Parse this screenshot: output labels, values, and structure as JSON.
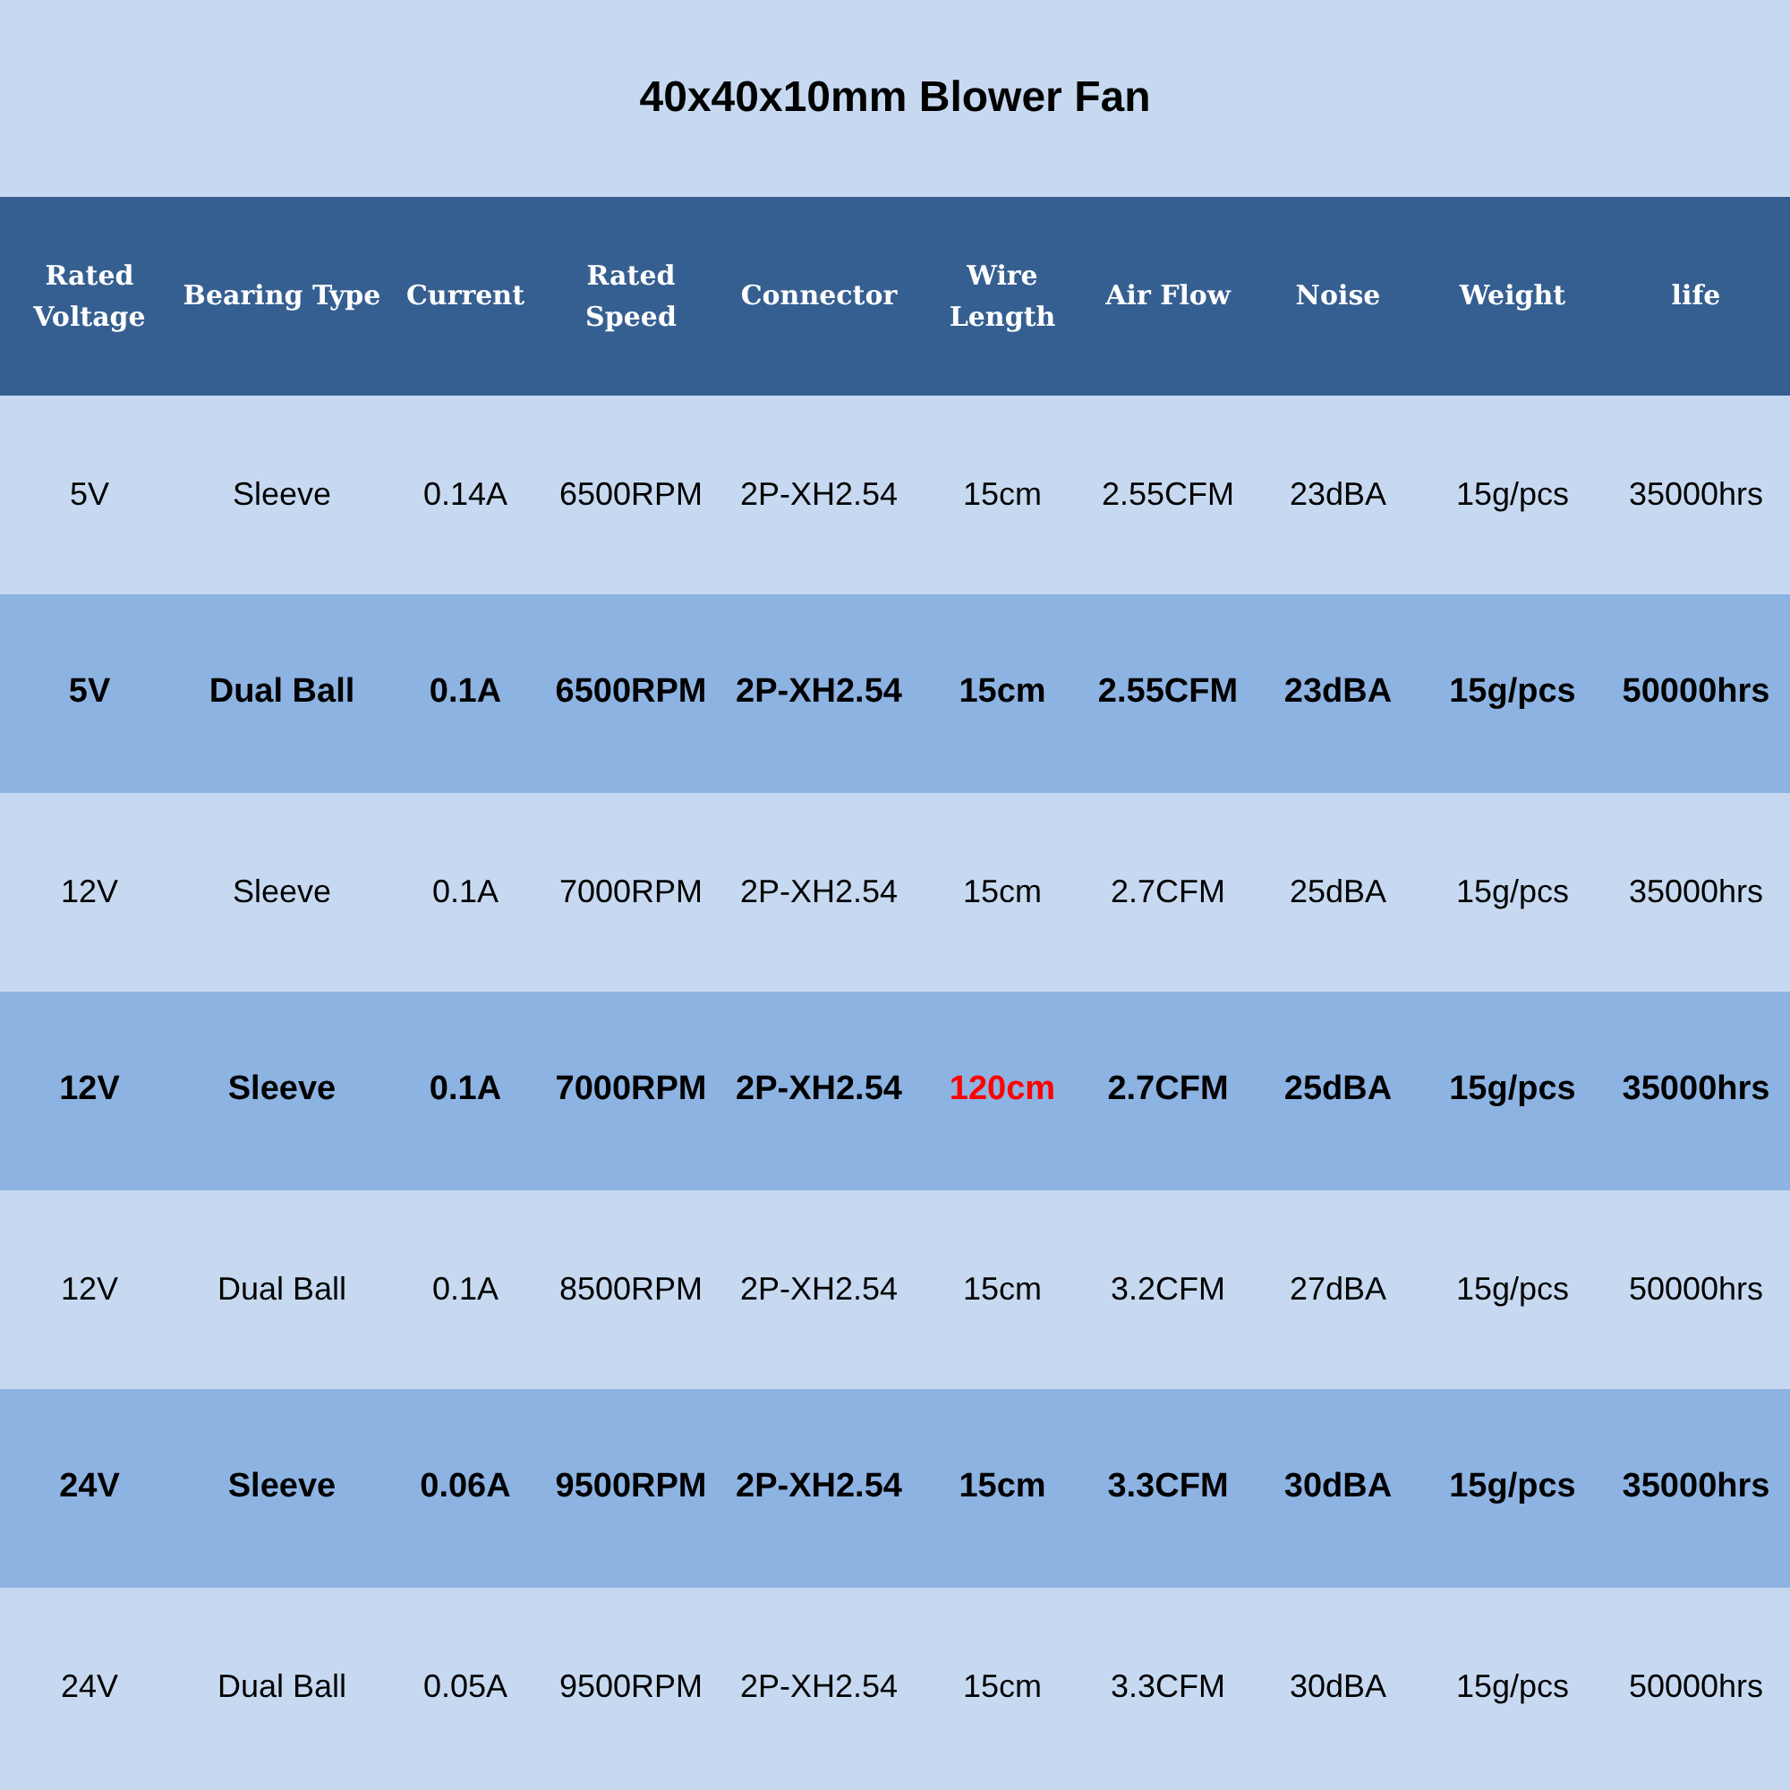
{
  "title": "40x40x10mm Blower Fan",
  "table": {
    "columns": [
      "Rated Voltage",
      "Bearing Type",
      "Current",
      "Rated Speed",
      "Connector",
      "Wire Length",
      "Air Flow",
      "Noise",
      "Weight",
      "life"
    ],
    "rows": [
      {
        "emphasized": false,
        "cells": [
          {
            "text": "5V",
            "highlight": false
          },
          {
            "text": "Sleeve",
            "highlight": false
          },
          {
            "text": "0.14A",
            "highlight": false
          },
          {
            "text": "6500RPM",
            "highlight": false
          },
          {
            "text": "2P-XH2.54",
            "highlight": false
          },
          {
            "text": "15cm",
            "highlight": false
          },
          {
            "text": "2.55CFM",
            "highlight": false
          },
          {
            "text": "23dBA",
            "highlight": false
          },
          {
            "text": "15g/pcs",
            "highlight": false
          },
          {
            "text": "35000hrs",
            "highlight": false
          }
        ]
      },
      {
        "emphasized": true,
        "cells": [
          {
            "text": "5V",
            "highlight": false
          },
          {
            "text": "Dual Ball",
            "highlight": false
          },
          {
            "text": "0.1A",
            "highlight": false
          },
          {
            "text": "6500RPM",
            "highlight": false
          },
          {
            "text": "2P-XH2.54",
            "highlight": false
          },
          {
            "text": "15cm",
            "highlight": false
          },
          {
            "text": "2.55CFM",
            "highlight": false
          },
          {
            "text": "23dBA",
            "highlight": false
          },
          {
            "text": "15g/pcs",
            "highlight": false
          },
          {
            "text": "50000hrs",
            "highlight": false
          }
        ]
      },
      {
        "emphasized": false,
        "cells": [
          {
            "text": "12V",
            "highlight": false
          },
          {
            "text": "Sleeve",
            "highlight": false
          },
          {
            "text": "0.1A",
            "highlight": false
          },
          {
            "text": "7000RPM",
            "highlight": false
          },
          {
            "text": "2P-XH2.54",
            "highlight": false
          },
          {
            "text": "15cm",
            "highlight": false
          },
          {
            "text": "2.7CFM",
            "highlight": false
          },
          {
            "text": "25dBA",
            "highlight": false
          },
          {
            "text": "15g/pcs",
            "highlight": false
          },
          {
            "text": "35000hrs",
            "highlight": false
          }
        ]
      },
      {
        "emphasized": true,
        "cells": [
          {
            "text": "12V",
            "highlight": false
          },
          {
            "text": "Sleeve",
            "highlight": false
          },
          {
            "text": "0.1A",
            "highlight": false
          },
          {
            "text": "7000RPM",
            "highlight": false
          },
          {
            "text": "2P-XH2.54",
            "highlight": false
          },
          {
            "text": "120cm",
            "highlight": true
          },
          {
            "text": "2.7CFM",
            "highlight": false
          },
          {
            "text": "25dBA",
            "highlight": false
          },
          {
            "text": "15g/pcs",
            "highlight": false
          },
          {
            "text": "35000hrs",
            "highlight": false
          }
        ]
      },
      {
        "emphasized": false,
        "cells": [
          {
            "text": "12V",
            "highlight": false
          },
          {
            "text": "Dual Ball",
            "highlight": false
          },
          {
            "text": "0.1A",
            "highlight": false
          },
          {
            "text": "8500RPM",
            "highlight": false
          },
          {
            "text": "2P-XH2.54",
            "highlight": false
          },
          {
            "text": "15cm",
            "highlight": false
          },
          {
            "text": "3.2CFM",
            "highlight": false
          },
          {
            "text": "27dBA",
            "highlight": false
          },
          {
            "text": "15g/pcs",
            "highlight": false
          },
          {
            "text": "50000hrs",
            "highlight": false
          }
        ]
      },
      {
        "emphasized": true,
        "cells": [
          {
            "text": "24V",
            "highlight": false
          },
          {
            "text": "Sleeve",
            "highlight": false
          },
          {
            "text": "0.06A",
            "highlight": false
          },
          {
            "text": "9500RPM",
            "highlight": false
          },
          {
            "text": "2P-XH2.54",
            "highlight": false
          },
          {
            "text": "15cm",
            "highlight": false
          },
          {
            "text": "3.3CFM",
            "highlight": false
          },
          {
            "text": "30dBA",
            "highlight": false
          },
          {
            "text": "15g/pcs",
            "highlight": false
          },
          {
            "text": "35000hrs",
            "highlight": false
          }
        ]
      },
      {
        "emphasized": false,
        "cells": [
          {
            "text": "24V",
            "highlight": false
          },
          {
            "text": "Dual Ball",
            "highlight": false
          },
          {
            "text": "0.05A",
            "highlight": false
          },
          {
            "text": "9500RPM",
            "highlight": false
          },
          {
            "text": "2P-XH2.54",
            "highlight": false
          },
          {
            "text": "15cm",
            "highlight": false
          },
          {
            "text": "3.3CFM",
            "highlight": false
          },
          {
            "text": "30dBA",
            "highlight": false
          },
          {
            "text": "15g/pcs",
            "highlight": false
          },
          {
            "text": "50000hrs",
            "highlight": false
          }
        ]
      }
    ]
  }
}
